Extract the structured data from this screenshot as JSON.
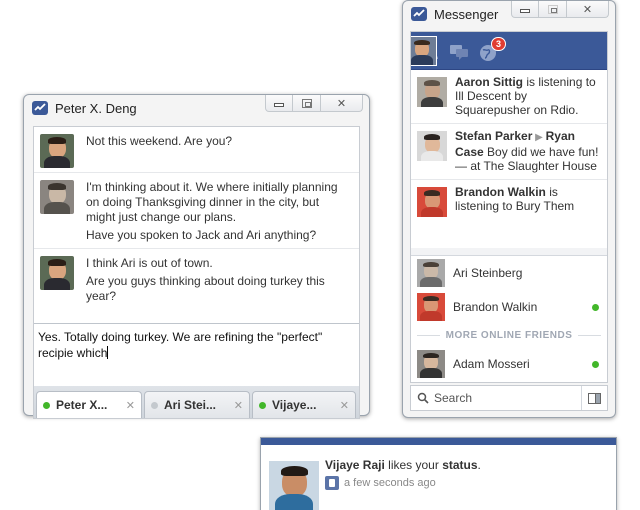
{
  "chat": {
    "title": "Peter X. Deng",
    "messages": [
      {
        "lines": [
          "Not this weekend. Are you?"
        ]
      },
      {
        "lines": [
          "I'm thinking about it. We where initially planning on doing Thanksgiving dinner in the city, but might just change our plans.",
          "Have you spoken to Jack and Ari anything?"
        ]
      },
      {
        "lines": [
          "I think Ari is out of town.",
          "Are you guys thinking about doing turkey this year?"
        ]
      }
    ],
    "compose_text": "Yes. Totally doing turkey. We are refining the \"perfect\" recipie which",
    "tabs": [
      {
        "label": "Peter X...",
        "status_color": "#42b72a",
        "active": true
      },
      {
        "label": "Ari Stei...",
        "status_color": "#c4c9ce",
        "active": false
      },
      {
        "label": "Vijaye...",
        "status_color": "#42b72a",
        "active": false
      }
    ]
  },
  "messenger": {
    "title": "Messenger",
    "notification_count": "3",
    "ticker": [
      {
        "name": "Aaron Sittig",
        "text": " is listening to Ill Descent by Squarepusher on Rdio."
      },
      {
        "name": "Stefan Parker",
        "arrow": " ▶ ",
        "target": "Ryan Case",
        "text": " Boy did we have fun! — at The Slaughter House"
      },
      {
        "name": "Brandon Walkin",
        "text": " is listening to Bury Them"
      }
    ],
    "friends": [
      {
        "name": "Ari Steinberg",
        "online": false
      },
      {
        "name": "Brandon Walkin",
        "online": true
      }
    ],
    "more_online_label": "MORE ONLINE FRIENDS",
    "more_friends": [
      {
        "name": "Adam Mosseri",
        "online": true
      }
    ],
    "search_label": "Search"
  },
  "notification": {
    "name": "Vijaye Raji",
    "action": " likes your ",
    "object": "status",
    "suffix": ".",
    "time": "a few seconds ago"
  },
  "colors": {
    "facebook_blue": "#3b5998",
    "online_green": "#42b72a",
    "badge_red": "#e03c31"
  }
}
